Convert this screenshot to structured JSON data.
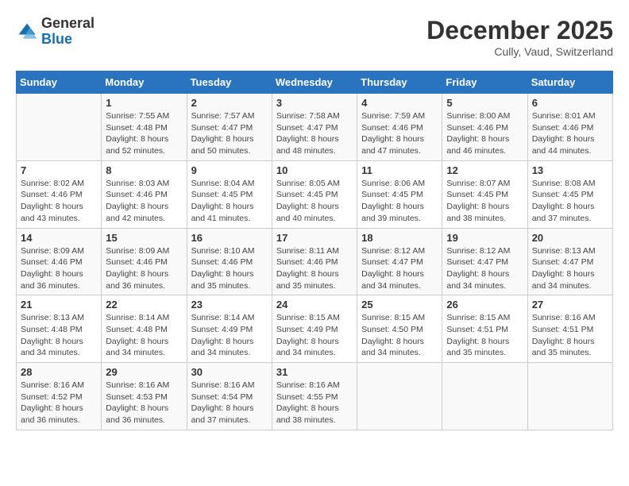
{
  "logo": {
    "general": "General",
    "blue": "Blue"
  },
  "title": "December 2025",
  "location": "Cully, Vaud, Switzerland",
  "weekdays": [
    "Sunday",
    "Monday",
    "Tuesday",
    "Wednesday",
    "Thursday",
    "Friday",
    "Saturday"
  ],
  "weeks": [
    [
      {
        "day": "",
        "info": ""
      },
      {
        "day": "1",
        "info": "Sunrise: 7:55 AM\nSunset: 4:48 PM\nDaylight: 8 hours\nand 52 minutes."
      },
      {
        "day": "2",
        "info": "Sunrise: 7:57 AM\nSunset: 4:47 PM\nDaylight: 8 hours\nand 50 minutes."
      },
      {
        "day": "3",
        "info": "Sunrise: 7:58 AM\nSunset: 4:47 PM\nDaylight: 8 hours\nand 48 minutes."
      },
      {
        "day": "4",
        "info": "Sunrise: 7:59 AM\nSunset: 4:46 PM\nDaylight: 8 hours\nand 47 minutes."
      },
      {
        "day": "5",
        "info": "Sunrise: 8:00 AM\nSunset: 4:46 PM\nDaylight: 8 hours\nand 46 minutes."
      },
      {
        "day": "6",
        "info": "Sunrise: 8:01 AM\nSunset: 4:46 PM\nDaylight: 8 hours\nand 44 minutes."
      }
    ],
    [
      {
        "day": "7",
        "info": "Sunrise: 8:02 AM\nSunset: 4:46 PM\nDaylight: 8 hours\nand 43 minutes."
      },
      {
        "day": "8",
        "info": "Sunrise: 8:03 AM\nSunset: 4:46 PM\nDaylight: 8 hours\nand 42 minutes."
      },
      {
        "day": "9",
        "info": "Sunrise: 8:04 AM\nSunset: 4:45 PM\nDaylight: 8 hours\nand 41 minutes."
      },
      {
        "day": "10",
        "info": "Sunrise: 8:05 AM\nSunset: 4:45 PM\nDaylight: 8 hours\nand 40 minutes."
      },
      {
        "day": "11",
        "info": "Sunrise: 8:06 AM\nSunset: 4:45 PM\nDaylight: 8 hours\nand 39 minutes."
      },
      {
        "day": "12",
        "info": "Sunrise: 8:07 AM\nSunset: 4:45 PM\nDaylight: 8 hours\nand 38 minutes."
      },
      {
        "day": "13",
        "info": "Sunrise: 8:08 AM\nSunset: 4:45 PM\nDaylight: 8 hours\nand 37 minutes."
      }
    ],
    [
      {
        "day": "14",
        "info": "Sunrise: 8:09 AM\nSunset: 4:46 PM\nDaylight: 8 hours\nand 36 minutes."
      },
      {
        "day": "15",
        "info": "Sunrise: 8:09 AM\nSunset: 4:46 PM\nDaylight: 8 hours\nand 36 minutes."
      },
      {
        "day": "16",
        "info": "Sunrise: 8:10 AM\nSunset: 4:46 PM\nDaylight: 8 hours\nand 35 minutes."
      },
      {
        "day": "17",
        "info": "Sunrise: 8:11 AM\nSunset: 4:46 PM\nDaylight: 8 hours\nand 35 minutes."
      },
      {
        "day": "18",
        "info": "Sunrise: 8:12 AM\nSunset: 4:47 PM\nDaylight: 8 hours\nand 34 minutes."
      },
      {
        "day": "19",
        "info": "Sunrise: 8:12 AM\nSunset: 4:47 PM\nDaylight: 8 hours\nand 34 minutes."
      },
      {
        "day": "20",
        "info": "Sunrise: 8:13 AM\nSunset: 4:47 PM\nDaylight: 8 hours\nand 34 minutes."
      }
    ],
    [
      {
        "day": "21",
        "info": "Sunrise: 8:13 AM\nSunset: 4:48 PM\nDaylight: 8 hours\nand 34 minutes."
      },
      {
        "day": "22",
        "info": "Sunrise: 8:14 AM\nSunset: 4:48 PM\nDaylight: 8 hours\nand 34 minutes."
      },
      {
        "day": "23",
        "info": "Sunrise: 8:14 AM\nSunset: 4:49 PM\nDaylight: 8 hours\nand 34 minutes."
      },
      {
        "day": "24",
        "info": "Sunrise: 8:15 AM\nSunset: 4:49 PM\nDaylight: 8 hours\nand 34 minutes."
      },
      {
        "day": "25",
        "info": "Sunrise: 8:15 AM\nSunset: 4:50 PM\nDaylight: 8 hours\nand 34 minutes."
      },
      {
        "day": "26",
        "info": "Sunrise: 8:15 AM\nSunset: 4:51 PM\nDaylight: 8 hours\nand 35 minutes."
      },
      {
        "day": "27",
        "info": "Sunrise: 8:16 AM\nSunset: 4:51 PM\nDaylight: 8 hours\nand 35 minutes."
      }
    ],
    [
      {
        "day": "28",
        "info": "Sunrise: 8:16 AM\nSunset: 4:52 PM\nDaylight: 8 hours\nand 36 minutes."
      },
      {
        "day": "29",
        "info": "Sunrise: 8:16 AM\nSunset: 4:53 PM\nDaylight: 8 hours\nand 36 minutes."
      },
      {
        "day": "30",
        "info": "Sunrise: 8:16 AM\nSunset: 4:54 PM\nDaylight: 8 hours\nand 37 minutes."
      },
      {
        "day": "31",
        "info": "Sunrise: 8:16 AM\nSunset: 4:55 PM\nDaylight: 8 hours\nand 38 minutes."
      },
      {
        "day": "",
        "info": ""
      },
      {
        "day": "",
        "info": ""
      },
      {
        "day": "",
        "info": ""
      }
    ]
  ]
}
